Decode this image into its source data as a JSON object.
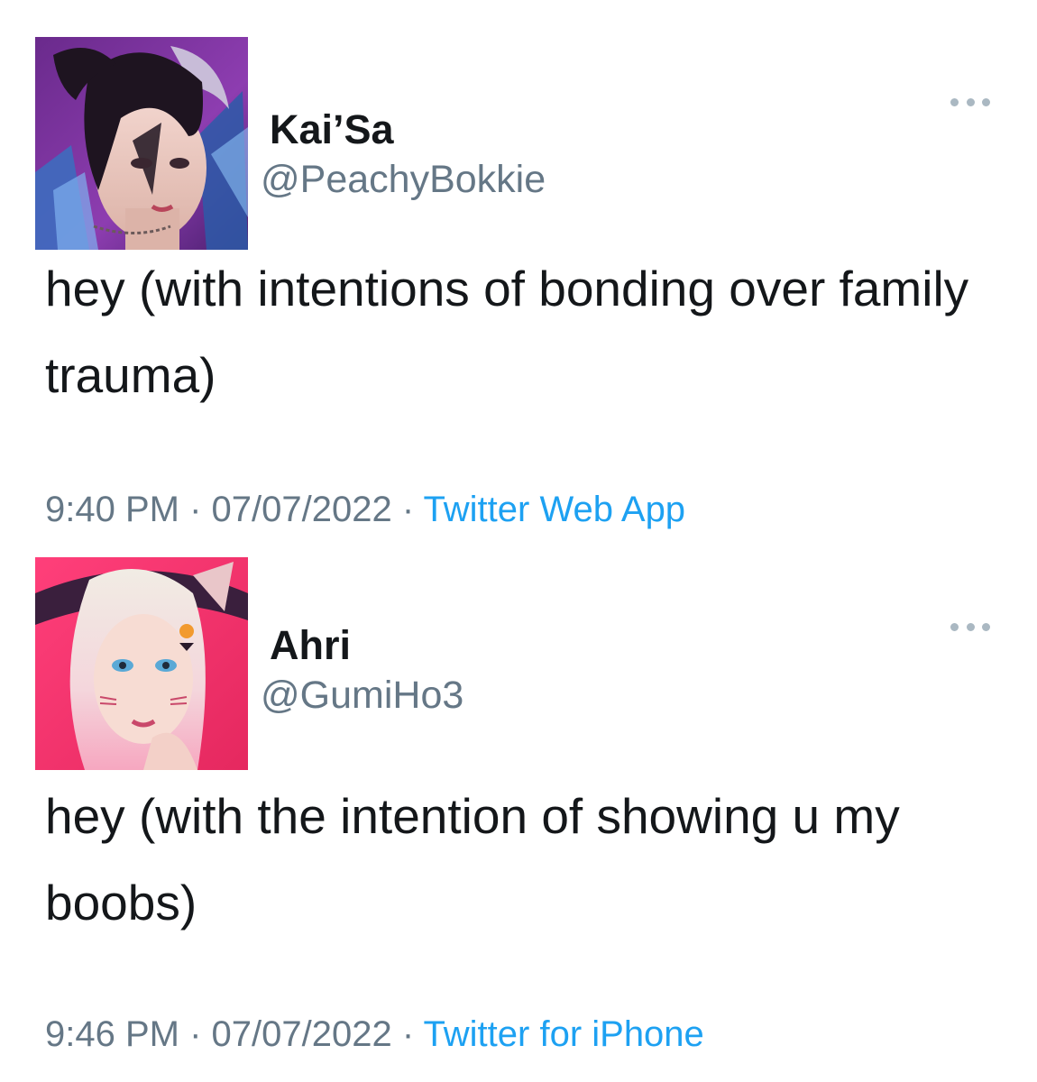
{
  "tweets": [
    {
      "display_name": "Kai’Sa",
      "handle": "@PeachyBokkie",
      "text": "hey (with intentions of bonding over family trauma)",
      "time": "9:40 PM",
      "separator": " · ",
      "date": "07/07/2022",
      "source": "Twitter Web App",
      "avatar_icon": "kaisa-avatar",
      "more_icon": "more-options-icon"
    },
    {
      "display_name": "Ahri",
      "handle": "@GumiHo3",
      "text": "hey (with the intention of showing u my boobs)",
      "time": "9:46 PM",
      "separator": " · ",
      "date": "07/07/2022",
      "source": "Twitter for iPhone",
      "avatar_icon": "ahri-avatar",
      "more_icon": "more-options-icon"
    }
  ],
  "colors": {
    "text_primary": "#14171a",
    "text_secondary": "#657786",
    "link": "#1da1f2",
    "more_dots": "#aab8c2",
    "background": "#ffffff"
  }
}
